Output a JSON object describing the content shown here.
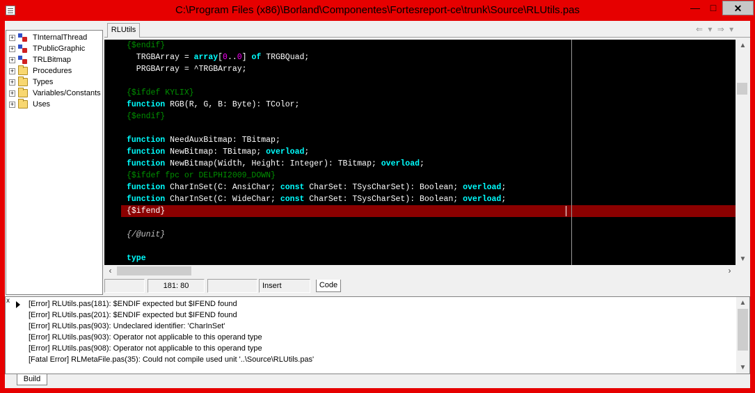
{
  "window": {
    "title": "C:\\Program Files (x86)\\Borland\\Componentes\\Fortesreport-ce\\trunk\\Source\\RLUtils.pas",
    "min_glyph": "—",
    "max_glyph": "□",
    "close_glyph": "✕"
  },
  "tree": {
    "items": [
      {
        "label": "TInternalThread",
        "icon": "class-icon"
      },
      {
        "label": "TPublicGraphic",
        "icon": "class-icon"
      },
      {
        "label": "TRLBitmap",
        "icon": "class-icon"
      },
      {
        "label": "Procedures",
        "icon": "folder-icon"
      },
      {
        "label": "Types",
        "icon": "folder-icon"
      },
      {
        "label": "Variables/Constants",
        "icon": "folder-icon"
      },
      {
        "label": "Uses",
        "icon": "folder-icon"
      }
    ],
    "expander": "+"
  },
  "editor": {
    "tab": "RLUtils",
    "nav": "⇐ ▾ ⇒ ▾",
    "lines": [
      [
        {
          "t": "{$endif}",
          "c": "cm"
        }
      ],
      [
        {
          "t": "  TRGBArray = ",
          "c": "id"
        },
        {
          "t": "array",
          "c": "kw"
        },
        {
          "t": "[",
          "c": "id"
        },
        {
          "t": "0",
          "c": "num"
        },
        {
          "t": "..",
          "c": "id"
        },
        {
          "t": "0",
          "c": "num"
        },
        {
          "t": "] ",
          "c": "id"
        },
        {
          "t": "of",
          "c": "kw"
        },
        {
          "t": " TRGBQuad;",
          "c": "id"
        }
      ],
      [
        {
          "t": "  PRGBArray = ^TRGBArray;",
          "c": "id"
        }
      ],
      [],
      [
        {
          "t": "{$ifdef KYLIX}",
          "c": "cm"
        }
      ],
      [
        {
          "t": "function",
          "c": "kw"
        },
        {
          "t": " RGB(R, G, B: Byte): TColor;",
          "c": "id"
        }
      ],
      [
        {
          "t": "{$endif}",
          "c": "cm"
        }
      ],
      [],
      [
        {
          "t": "function",
          "c": "kw"
        },
        {
          "t": " NeedAuxBitmap: TBitmap;",
          "c": "id"
        }
      ],
      [
        {
          "t": "function",
          "c": "kw"
        },
        {
          "t": " NewBitmap: TBitmap; ",
          "c": "id"
        },
        {
          "t": "overload",
          "c": "kw"
        },
        {
          "t": ";",
          "c": "id"
        }
      ],
      [
        {
          "t": "function",
          "c": "kw"
        },
        {
          "t": " NewBitmap(Width, Height: Integer): TBitmap; ",
          "c": "id"
        },
        {
          "t": "overload",
          "c": "kw"
        },
        {
          "t": ";",
          "c": "id"
        }
      ],
      [
        {
          "t": "{$ifdef fpc or DELPHI2009_DOWN}",
          "c": "cm"
        }
      ],
      [
        {
          "t": "function",
          "c": "kw"
        },
        {
          "t": " CharInSet(C: AnsiChar; ",
          "c": "id"
        },
        {
          "t": "const",
          "c": "kw"
        },
        {
          "t": " CharSet: TSysCharSet): Boolean; ",
          "c": "id"
        },
        {
          "t": "overload",
          "c": "kw"
        },
        {
          "t": ";",
          "c": "id"
        }
      ],
      [
        {
          "t": "function",
          "c": "kw"
        },
        {
          "t": " CharInSet(C: WideChar; ",
          "c": "id"
        },
        {
          "t": "const",
          "c": "kw"
        },
        {
          "t": " CharSet: TSysCharSet): Boolean; ",
          "c": "id"
        },
        {
          "t": "overload",
          "c": "kw"
        },
        {
          "t": ";",
          "c": "id"
        }
      ],
      [
        {
          "t": "{$ifend}",
          "c": "id"
        }
      ],
      [],
      [
        {
          "t": "{/@unit}",
          "c": "it"
        }
      ],
      [],
      [
        {
          "t": "type",
          "c": "kw"
        }
      ]
    ],
    "error_line_index": 14,
    "colors": {
      "background": "#000000",
      "keyword": "#00ffff",
      "comment": "#009000",
      "error_line": "#8b0000"
    }
  },
  "status": {
    "position": "181:  80",
    "mode": "Insert",
    "tab": "Code"
  },
  "messages": {
    "items": [
      "[Error] RLUtils.pas(181): $ENDIF expected but $IFEND found",
      "[Error] RLUtils.pas(201): $ENDIF expected but $IFEND found",
      "[Error] RLUtils.pas(903): Undeclared identifier: 'CharInSet'",
      "[Error] RLUtils.pas(903): Operator not applicable to this operand type",
      "[Error] RLUtils.pas(908): Operator not applicable to this operand type",
      "[Fatal Error] RLMetaFile.pas(35): Could not compile used unit '..\\Source\\RLUtils.pas'"
    ],
    "tab": "Build",
    "close_glyph": "x"
  }
}
